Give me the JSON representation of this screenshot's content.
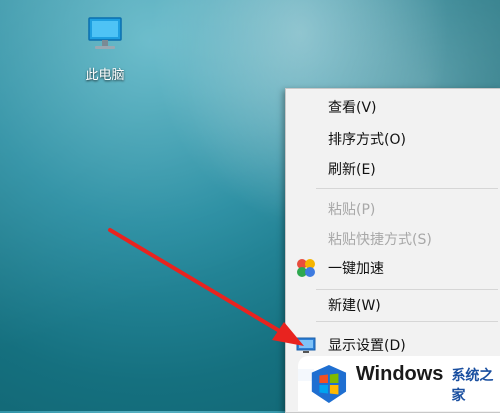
{
  "desktop": {
    "icon_label": "此电脑"
  },
  "context_menu": {
    "items": [
      {
        "label": "查看(V)",
        "enabled": true
      },
      {
        "label": "排序方式(O)",
        "enabled": true
      },
      {
        "label": "刷新(E)",
        "enabled": true
      },
      {
        "label": "粘贴(P)",
        "enabled": false
      },
      {
        "label": "粘贴快捷方式(S)",
        "enabled": false
      },
      {
        "label": "一键加速",
        "enabled": true,
        "icon": "speedup-icon"
      },
      {
        "label": "新建(W)",
        "enabled": true
      },
      {
        "label": "显示设置(D)",
        "enabled": true,
        "icon": "display-icon"
      }
    ]
  },
  "watermark": {
    "brand": "Windows",
    "site": "系统之家"
  },
  "colors": {
    "arrow": "#e8231f",
    "menu_bg": "#f2f2f2",
    "disabled_text": "#a8a8a8"
  }
}
